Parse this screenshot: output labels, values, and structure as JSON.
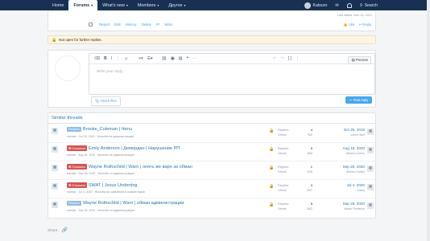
{
  "nav": {
    "tabs": [
      {
        "label": "Home",
        "active": false,
        "caret": false
      },
      {
        "label": "Forums",
        "active": true,
        "caret": true
      },
      {
        "label": "What's new",
        "active": false,
        "caret": true
      },
      {
        "label": "Members",
        "active": false,
        "caret": true
      },
      {
        "label": "Другое",
        "active": false,
        "caret": true
      }
    ],
    "user": "Katsuro",
    "search": "Search"
  },
  "post": {
    "last_updated": "Last edited: Nov 13, 2021",
    "actions": [
      "Report",
      "Edit",
      "History",
      "Delete",
      "IP",
      "Warn"
    ],
    "like": "Like",
    "reply": "Reply"
  },
  "notice": "Not open for further replies.",
  "editor": {
    "placeholder": "Write your reply...",
    "preview": "Preview",
    "attach": "Attach files",
    "post_reply": "Post reply"
  },
  "similar": {
    "heading": "Similar threads",
    "labels": {
      "replies": "Replies",
      "views": "Views"
    },
    "threads": [
      {
        "badge": "Решено",
        "badge_color": "blue",
        "title": "Brooke_Coleman | Читы",
        "meta": "namiok · Oct 28, 2019 · Жалобы на администрацию",
        "replies": "4",
        "views": "752",
        "date": "Oct 29, 2019",
        "who": "Vortex Wolf"
      },
      {
        "badge": "✖ Отказано",
        "badge_color": "red",
        "title": "Emily Anderson | Демордан | Нарушение РП",
        "meta": "namiok · Aug 18, 2020 · Жалобы на администрацию",
        "replies": "5",
        "views": "384",
        "date": "Aug 18, 2020",
        "who": "Alfonso Corleo"
      },
      {
        "badge": "✖ Отказано",
        "badge_color": "red",
        "title": "Wayne Rothschild | Warn | опять же варн за обман",
        "meta": "namiok · Sep 28, 2020 · Жалобы на администрацию",
        "replies": "1",
        "views": "525",
        "date": "Sep 28, 2020",
        "who": "Alfonso Corleo"
      },
      {
        "badge": "✖ Отказано",
        "badge_color": "red",
        "title": "SWAT | Jesus Underdog",
        "meta": "namiok · Jul 4, 2020 · Жалобы на заявления и комментарии",
        "replies": "3",
        "views": "547",
        "date": "Jul 4, 2020",
        "who": "Laaky"
      },
      {
        "badge": "Решено",
        "badge_color": "blue",
        "title": "Wayne Rothschild | Warn | обман администрации",
        "meta": "namiok · Sep 28, 2020 · Жалобы на администрацию",
        "replies": "5",
        "views": "582",
        "date": "Sep 28, 2020",
        "who": "Alvaro Frederico"
      }
    ]
  },
  "share": "Share:"
}
